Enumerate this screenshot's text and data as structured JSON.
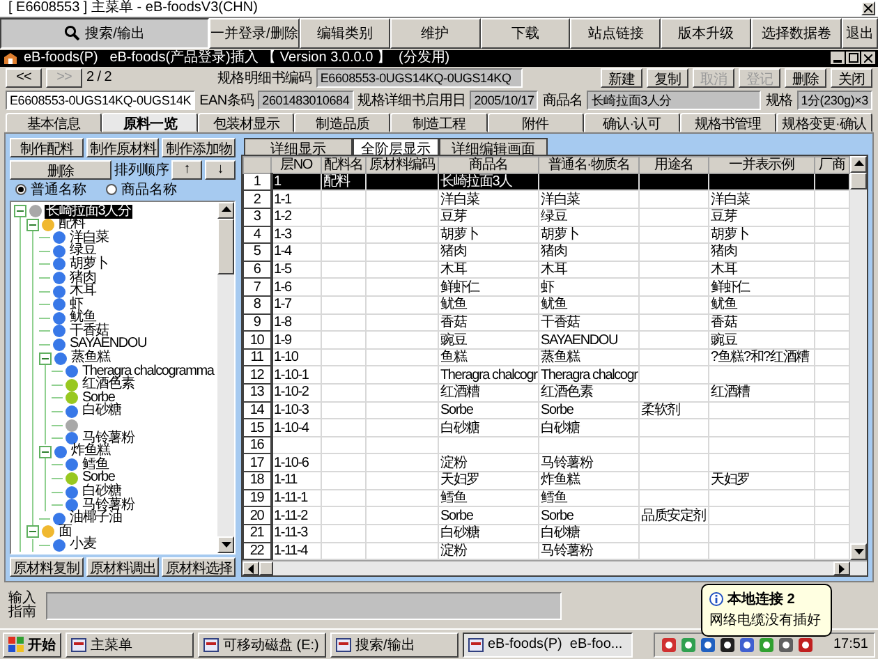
{
  "window": {
    "title": "[ E6608553 ] 主菜单 - eB-foodsV3(CHN)"
  },
  "menu": [
    {
      "label": "搜索/输出",
      "selected": true,
      "has_icon": true
    },
    {
      "label": "一并登录/删除",
      "selected": false,
      "has_icon": false
    },
    {
      "label": "编辑类别",
      "selected": false,
      "has_icon": false
    },
    {
      "label": "维护",
      "selected": false,
      "has_icon": false
    },
    {
      "label": "下载",
      "selected": false,
      "has_icon": false
    },
    {
      "label": "站点链接",
      "selected": false,
      "has_icon": false
    },
    {
      "label": "版本升级",
      "selected": false,
      "has_icon": false
    },
    {
      "label": "选择数据卷",
      "selected": false,
      "has_icon": false
    },
    {
      "label": "退出",
      "selected": false,
      "has_icon": false
    }
  ],
  "inner_window": {
    "title": "eB-foods(P)   eB-foods(产品登录)插入 【 Version 3.0.0.0 】  (分发用)"
  },
  "nav": {
    "prev": "<<",
    "next": ">>",
    "page": "2 / 2"
  },
  "code": {
    "label": "规格明细书编码",
    "value": "E6608553-0UGS14KQ-0UGS14KQ"
  },
  "actions": [
    {
      "label": "新建",
      "disabled": false
    },
    {
      "label": "复制",
      "disabled": false
    },
    {
      "label": "取消",
      "disabled": true
    },
    {
      "label": "登记",
      "disabled": true
    },
    {
      "label": "删除",
      "disabled": false
    },
    {
      "label": "关闭",
      "disabled": false
    }
  ],
  "fields": [
    {
      "value": "E6608553-0UGS14KQ-0UGS14K"
    },
    {
      "label": "EAN条码",
      "value": "2601483010684"
    },
    {
      "label": "规格详细书启用日",
      "value": "2005/10/17"
    },
    {
      "label": "商品名",
      "value": "长崎拉面3人分"
    },
    {
      "label": "规格",
      "value": "1分(230g)×3"
    }
  ],
  "tabs": [
    {
      "label": "基本信息",
      "selected": false
    },
    {
      "label": "原料一览",
      "selected": true
    },
    {
      "label": "包装材显示",
      "selected": false
    },
    {
      "label": "制造品质",
      "selected": false
    },
    {
      "label": "制造工程",
      "selected": false
    },
    {
      "label": "附件",
      "selected": false
    },
    {
      "label": "确认·认可",
      "selected": false
    },
    {
      "label": "规格书管理",
      "selected": false
    },
    {
      "label": "规格变更·确认",
      "selected": false
    }
  ],
  "left": {
    "make_buttons": [
      "制作配料",
      "制作原材料",
      "制作添加物"
    ],
    "delete": "删除",
    "order_label": "排列顺序",
    "up": "↑",
    "down": "↓"
  },
  "radios": [
    {
      "label": "普通名称",
      "selected": true
    },
    {
      "label": "商品名称",
      "selected": false
    }
  ],
  "tree": [
    {
      "label": "长崎拉面3人分",
      "color": "#a8a8a8",
      "selected": true,
      "expanded": true,
      "children": [
        {
          "label": "配料",
          "color": "#f0b830",
          "selected": false,
          "expanded": true,
          "children": [
            {
              "label": "洋白菜",
              "color": "#3878e8",
              "selected": false
            },
            {
              "label": "绿豆",
              "color": "#3878e8",
              "selected": false
            },
            {
              "label": "胡萝卜",
              "color": "#3878e8",
              "selected": false
            },
            {
              "label": "猪肉",
              "color": "#3878e8",
              "selected": false
            },
            {
              "label": "木耳",
              "color": "#3878e8",
              "selected": false
            },
            {
              "label": "虾",
              "color": "#3878e8",
              "selected": false
            },
            {
              "label": "鱿鱼",
              "color": "#3878e8",
              "selected": false
            },
            {
              "label": "干香菇",
              "color": "#3878e8",
              "selected": false
            },
            {
              "label": "SAYAENDOU",
              "color": "#3878e8",
              "selected": false
            },
            {
              "label": "蒸鱼糕",
              "color": "#3878e8",
              "selected": false,
              "expanded": true,
              "children": [
                {
                  "label": "Theragra chalcogramma",
                  "color": "#3878e8",
                  "selected": false
                },
                {
                  "label": "红酒色素",
                  "color": "#98c820",
                  "selected": false
                },
                {
                  "label": "Sorbe",
                  "color": "#98c820",
                  "selected": false
                },
                {
                  "label": "白砂糖",
                  "color": "#3878e8",
                  "selected": false
                },
                {
                  "color": "#a8a8a8",
                  "selected": false
                },
                {
                  "label": "马铃薯粉",
                  "color": "#3878e8",
                  "selected": false
                }
              ]
            },
            {
              "label": "炸鱼糕",
              "color": "#3878e8",
              "selected": false,
              "expanded": true,
              "children": [
                {
                  "label": "鳕鱼",
                  "color": "#3878e8",
                  "selected": false
                },
                {
                  "label": "Sorbe",
                  "color": "#98c820",
                  "selected": false
                },
                {
                  "label": "白砂糖",
                  "color": "#3878e8",
                  "selected": false
                },
                {
                  "label": "马铃薯粉",
                  "color": "#3878e8",
                  "selected": false
                }
              ]
            },
            {
              "label": "油椰子油",
              "color": "#3878e8",
              "selected": false
            }
          ]
        },
        {
          "label": "面",
          "color": "#f0b830",
          "selected": false,
          "expanded": true,
          "children": [
            {
              "label": "小麦",
              "color": "#3878e8",
              "selected": false
            }
          ]
        }
      ]
    }
  ],
  "bottom_buttons": [
    "原材料复制",
    "原材料调出",
    "原材料选择"
  ],
  "subtabs": [
    {
      "label": "详细显示",
      "selected": false
    },
    {
      "label": "全阶层显示",
      "selected": true
    },
    {
      "label": "详细编辑画面",
      "selected": false
    }
  ],
  "table": {
    "columns": [
      "层NO",
      "配料名",
      "原材料编码",
      "商品名",
      "普通名·物质名",
      "用途名",
      "一并表示例",
      "厂商"
    ],
    "rows": [
      {
        "number": "1",
        "selected": true,
        "cells": [
          "1",
          "配料",
          null,
          "长崎拉面3人",
          null,
          null,
          null,
          null
        ]
      },
      {
        "number": "2",
        "selected": false,
        "cells": [
          "1-1",
          null,
          null,
          "洋白菜",
          "洋白菜",
          null,
          "洋白菜",
          null
        ]
      },
      {
        "number": "3",
        "selected": false,
        "cells": [
          "1-2",
          null,
          null,
          "豆芽",
          "绿豆",
          null,
          "豆芽",
          null
        ]
      },
      {
        "number": "4",
        "selected": false,
        "cells": [
          "1-3",
          null,
          null,
          "胡萝卜",
          "胡萝卜",
          null,
          "胡萝卜",
          null
        ]
      },
      {
        "number": "5",
        "selected": false,
        "cells": [
          "1-4",
          null,
          null,
          "猪肉",
          "猪肉",
          null,
          "猪肉",
          null
        ]
      },
      {
        "number": "6",
        "selected": false,
        "cells": [
          "1-5",
          null,
          null,
          "木耳",
          "木耳",
          null,
          "木耳",
          null
        ]
      },
      {
        "number": "7",
        "selected": false,
        "cells": [
          "1-6",
          null,
          null,
          "鲜虾仁",
          "虾",
          null,
          "鲜虾仁",
          null
        ]
      },
      {
        "number": "8",
        "selected": false,
        "cells": [
          "1-7",
          null,
          null,
          "鱿鱼",
          "鱿鱼",
          null,
          "鱿鱼",
          null
        ]
      },
      {
        "number": "9",
        "selected": false,
        "cells": [
          "1-8",
          null,
          null,
          "香菇",
          "干香菇",
          null,
          "香菇",
          null
        ]
      },
      {
        "number": "10",
        "selected": false,
        "cells": [
          "1-9",
          null,
          null,
          "豌豆",
          "SAYAENDOU",
          null,
          "豌豆",
          null
        ]
      },
      {
        "number": "11",
        "selected": false,
        "cells": [
          "1-10",
          null,
          null,
          "鱼糕",
          "蒸鱼糕",
          null,
          "?鱼糕?和?红酒糟",
          null
        ]
      },
      {
        "number": "12",
        "selected": false,
        "cells": [
          "1-10-1",
          null,
          null,
          "Theragra chalcogr",
          "Theragra chalcogr",
          null,
          null,
          null
        ]
      },
      {
        "number": "13",
        "selected": false,
        "cells": [
          "1-10-2",
          null,
          null,
          "红酒糟",
          "红酒色素",
          null,
          "红酒糟",
          null
        ]
      },
      {
        "number": "14",
        "selected": false,
        "cells": [
          "1-10-3",
          null,
          null,
          "Sorbe",
          "Sorbe",
          "柔软剂",
          null,
          null
        ]
      },
      {
        "number": "15",
        "selected": false,
        "cells": [
          "1-10-4",
          null,
          null,
          "白砂糖",
          "白砂糖",
          null,
          null,
          null
        ]
      },
      {
        "number": "16",
        "selected": false,
        "cells": [
          null,
          null,
          null,
          null,
          null,
          null,
          null,
          null
        ]
      },
      {
        "number": "17",
        "selected": false,
        "cells": [
          "1-10-6",
          null,
          null,
          "淀粉",
          "马铃薯粉",
          null,
          null,
          null
        ]
      },
      {
        "number": "18",
        "selected": false,
        "cells": [
          "1-11",
          null,
          null,
          "天妇罗",
          "炸鱼糕",
          null,
          "天妇罗",
          null
        ]
      },
      {
        "number": "19",
        "selected": false,
        "cells": [
          "1-11-1",
          null,
          null,
          "鳕鱼",
          "鳕鱼",
          null,
          null,
          null
        ]
      },
      {
        "number": "20",
        "selected": false,
        "cells": [
          "1-11-2",
          null,
          null,
          "Sorbe",
          "Sorbe",
          "品质安定剂",
          null,
          null
        ]
      },
      {
        "number": "21",
        "selected": false,
        "cells": [
          "1-11-3",
          null,
          null,
          "白砂糖",
          "白砂糖",
          null,
          null,
          null
        ]
      },
      {
        "number": "22",
        "selected": false,
        "cells": [
          "1-11-4",
          null,
          null,
          "淀粉",
          "马铃薯粉",
          null,
          null,
          null
        ]
      }
    ]
  },
  "input_guide": {
    "label": "输入指南"
  },
  "balloon": {
    "title": "本地连接 2",
    "message": "网络电缆没有插好"
  },
  "taskbar": {
    "start": "开始",
    "items": [
      {
        "label": "主菜单",
        "selected": false
      },
      {
        "label": "可移动磁盘 (E:)",
        "selected": false
      },
      {
        "label": "搜索/输出",
        "selected": false
      },
      {
        "label": "eB-foods(P)  eB-foo...",
        "selected": true
      }
    ],
    "clock": "17:51"
  }
}
